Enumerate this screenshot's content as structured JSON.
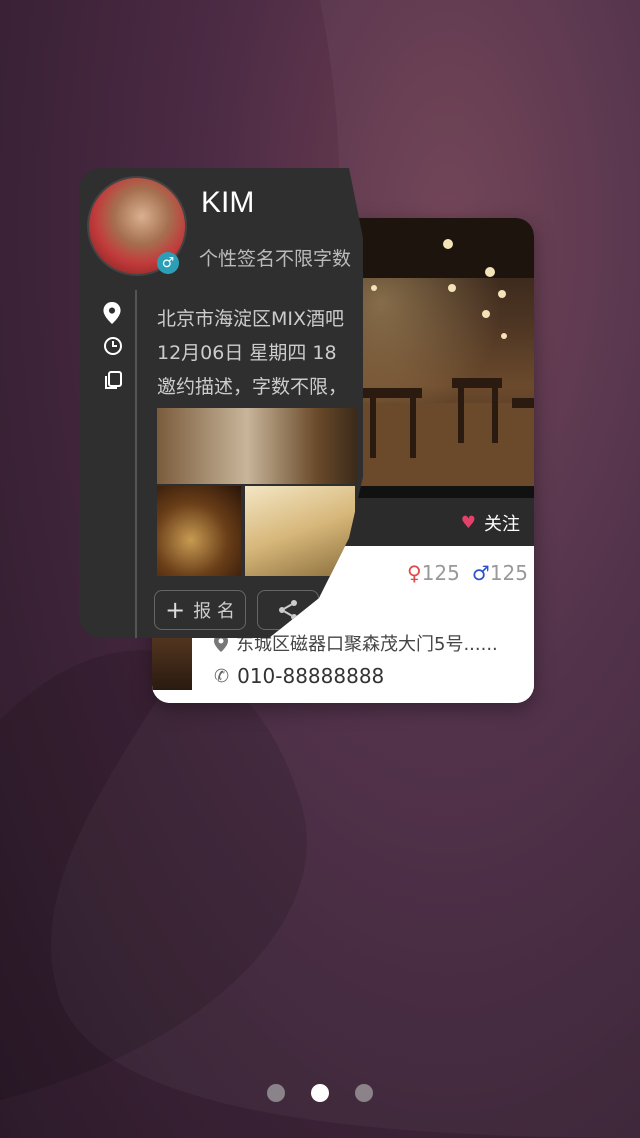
{
  "profile": {
    "name": "KIM",
    "signature": "个性签名不限字数",
    "location": "北京市海淀区MIX酒吧",
    "datetime": "12月06日   星期四   18",
    "description": "邀约描述，字数不限，",
    "signup_label": "报 名"
  },
  "venue": {
    "follow_label": "关注",
    "female_count": "125",
    "male_count": "125",
    "address": "东城区磁器口聚森茂大门5号......",
    "phone": "010-88888888"
  },
  "pager": {
    "total": 3,
    "current": 2
  },
  "colors": {
    "accent_heart": "#e3406a",
    "female": "#e04848",
    "male": "#2c52c8",
    "gender_badge": "#2b9fb6"
  }
}
